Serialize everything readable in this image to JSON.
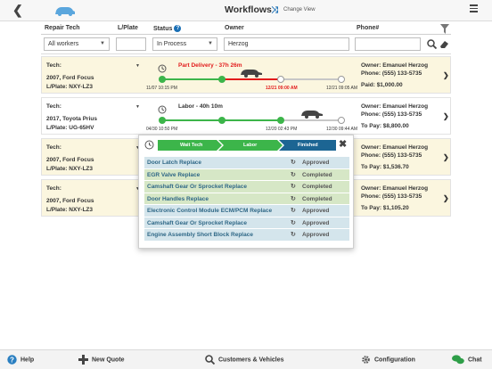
{
  "topbar": {
    "title": "Workflows",
    "change_view_label": "Change View"
  },
  "filters": {
    "headers": {
      "repair_tech": "Repair Tech",
      "plate": "L/Plate",
      "status": "Status",
      "owner": "Owner",
      "phone": "Phone#"
    },
    "repair_tech_value": "All workers",
    "plate_value": "",
    "status_value": "In Process",
    "owner_value": "Herzog",
    "phone_value": ""
  },
  "rows": [
    {
      "tech": "Tech:",
      "vehicle": "2007, Ford Focus",
      "plate": "L/Plate: NXY-LZ3",
      "status_text": "Part Delivery - 37h 26m",
      "status_color": "#e21b1b",
      "date_start": "11/07 10:15 PM",
      "date_mid": "12/21 09:00 AM",
      "date_end": "12/21 09:05 AM",
      "owner": "Owner: Emanuel Herzog",
      "phone": "Phone: (555) 133-5735",
      "payment": "Paid: $1,000.00"
    },
    {
      "tech": "Tech:",
      "vehicle": "2017, Toyota Prius",
      "plate": "L/Plate: UG-65HV",
      "status_text": "Labor - 40h 10m",
      "status_color": "#333333",
      "date_start": "04/30 10:50 PM",
      "date_mid": "12/20 02:43 PM",
      "date_end": "12/30 09:44 AM",
      "owner": "Owner: Emanuel Herzog",
      "phone": "Phone: (555) 133-5735",
      "payment": "To Pay: $8,800.00"
    },
    {
      "tech": "Tech:",
      "vehicle": "2007, Ford Focus",
      "plate": "L/Plate: NXY-LZ3",
      "owner": "Owner: Emanuel Herzog",
      "phone": "Phone: (555) 133-5735",
      "payment": "To Pay: $1,536.70"
    },
    {
      "tech": "Tech:",
      "vehicle": "2007, Ford Focus",
      "plate": "L/Plate: NXY-LZ3",
      "owner": "Owner: Emanuel Herzog",
      "phone": "Phone: (555) 133-5735",
      "payment": "To Pay: $1,105.20"
    }
  ],
  "popup": {
    "steps": [
      "Wait Tech",
      "Labor",
      "Finished"
    ],
    "items": [
      {
        "name": "Door Latch Replace",
        "status": "Approved"
      },
      {
        "name": "EGR Valve Replace",
        "status": "Completed"
      },
      {
        "name": "Camshaft Gear Or Sprocket Replace",
        "status": "Completed"
      },
      {
        "name": "Door Handles Replace",
        "status": "Completed"
      },
      {
        "name": "Electronic Control Module ECM/PCM Replace",
        "status": "Approved"
      },
      {
        "name": "Camshaft Gear Or Sprocket Replace",
        "status": "Approved"
      },
      {
        "name": "Engine Assembly Short Block Replace",
        "status": "Approved"
      }
    ]
  },
  "bottombar": {
    "help": "Help",
    "new_quote": "New Quote",
    "customers": "Customers & Vehicles",
    "configuration": "Configuration",
    "chat": "Chat"
  },
  "colors": {
    "accent": "#1a6fb5",
    "green": "#3cb54a",
    "red": "#e21b1b",
    "row_highlight": "#fbf6df",
    "step_blue": "#1c6593",
    "chat_green": "#2e9e48"
  }
}
